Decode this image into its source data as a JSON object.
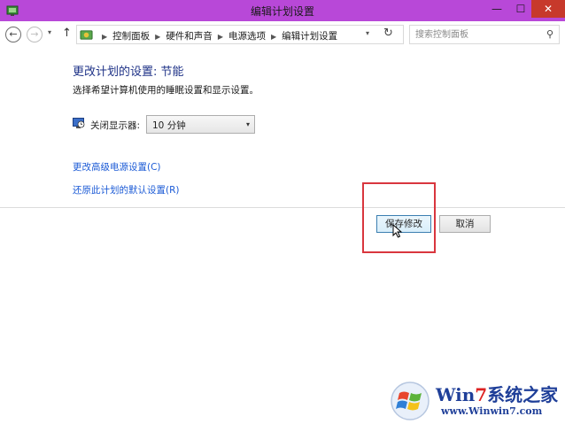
{
  "window": {
    "title": "编辑计划设置",
    "min_label": "—",
    "max_label": "☐",
    "close_label": "✕"
  },
  "nav": {
    "back_label": "←",
    "forward_label": "→",
    "recent_label": "▾",
    "up_label": "↑",
    "breadcrumbs": [
      "控制面板",
      "硬件和声音",
      "电源选项",
      "编辑计划设置"
    ],
    "breadcrumb_sep": "▶",
    "address_drop_label": "▾",
    "refresh_label": "↻",
    "search_placeholder": "搜索控制面板",
    "search_icon_label": "⚲"
  },
  "main": {
    "heading": "更改计划的设置: 节能",
    "description": "选择希望计算机使用的睡眠设置和显示设置。",
    "display_off_label": "关闭显示器:",
    "display_off_value": "10 分钟",
    "select_arrow": "▾",
    "advanced_link": "更改高级电源设置(C)",
    "restore_link": "还原此计划的默认设置(R)",
    "save_button": "保存修改",
    "cancel_button": "取消"
  },
  "watermark": {
    "brand_prefix": "Win",
    "brand_seven": "7",
    "brand_suffix": "系统之家",
    "url": "www.Winwin7.com"
  },
  "colors": {
    "titlebar": "#b848d8",
    "close_button": "#c7392b",
    "heading": "#1e3287",
    "link": "#1c5bd6",
    "highlight": "#d9363e"
  }
}
